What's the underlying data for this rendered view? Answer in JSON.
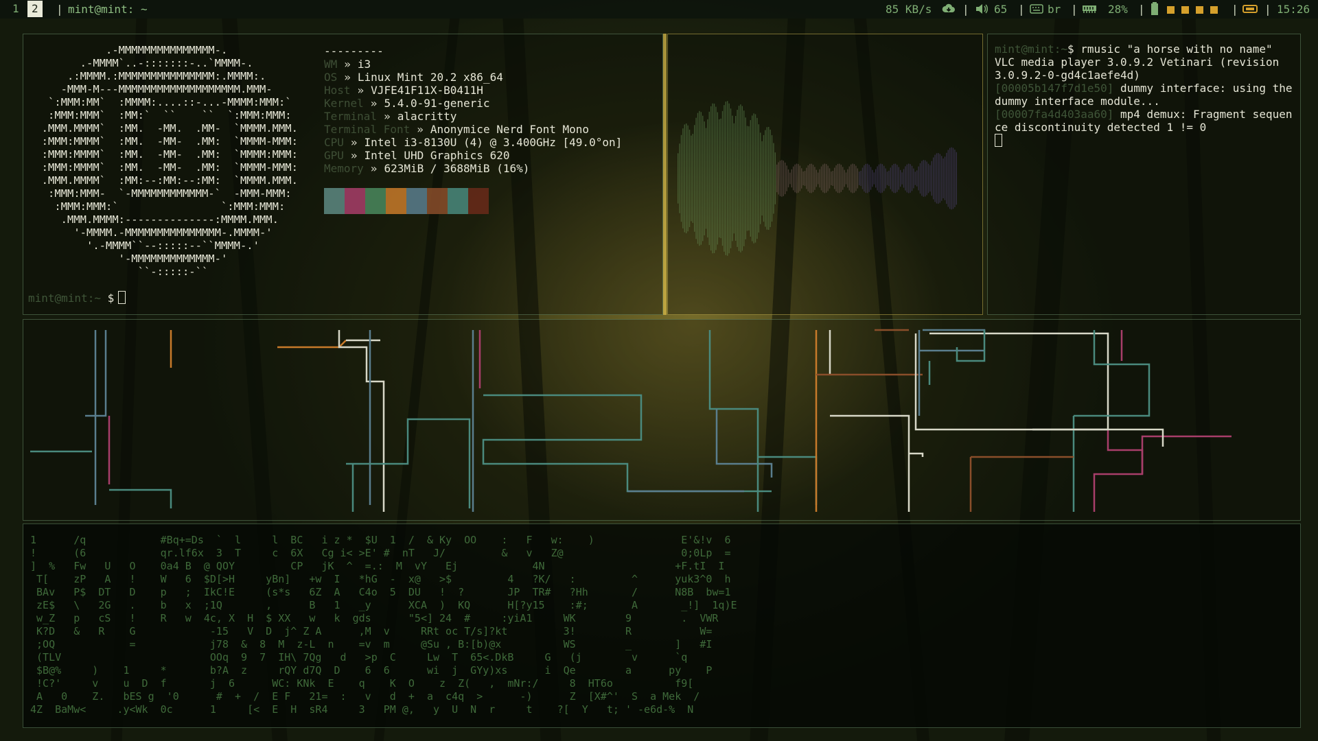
{
  "topbar": {
    "workspaces": [
      "1",
      "2"
    ],
    "active_workspace": "2",
    "window_title": "mint@mint: ~",
    "net_speed": "85 KB/s",
    "volume": "65",
    "keyboard_layout": "br",
    "memory_percent": "28%",
    "clock": "15:26",
    "icons": [
      "cloud-download-icon",
      "speaker-icon",
      "keyboard-icon",
      "memory-icon",
      "battery-icon",
      "ethernet-icon"
    ],
    "accent": "#d5a02c"
  },
  "neofetch": {
    "ascii_logo": "            .-MMMMMMMMMMMMMMM-.\n        .-MMMM`..-:::::::-..`MMMM-.\n      .:MMMM.:MMMMMMMMMMMMMMM:.MMMM:.\n     -MMM-M---MMMMMMMMMMMMMMMMMMM.MMM-\n   `:MMM:MM`  :MMMM:....::-...-MMMM:MMM:`\n   :MMM:MMM`  :MM:`  ``    ``  `:MMM:MMM:\n  .MMM.MMMM`  :MM.  -MM.  .MM-  `MMMM.MMM.\n  :MMM:MMMM`  :MM.  -MM-  .MM:  `MMMM-MMM:\n  :MMM:MMMM`  :MM.  -MM-  .MM:  `MMMM:MMM:\n  :MMM:MMMM`  :MM.  -MM-  .MM:  `MMMM-MMM:\n  .MMM.MMMM`  :MM:--:MM:--:MM:  `MMMM.MMM.\n   :MMM:MMM-  `-MMMMMMMMMMMM-`  -MMM-MMM:\n    :MMM:MMM:`                `:MMM:MMM:\n     .MMM.MMMM:--------------:MMMM.MMM.\n       '-MMMM.-MMMMMMMMMMMMMMM-.MMMM-'\n         '.-MMMM``--:::::--``MMMM-.'\n              '-MMMMMMMMMMMMM-'\n                 ``-:::::-``",
    "separator": "---------",
    "info": [
      {
        "key": "WM",
        "value": "i3"
      },
      {
        "key": "OS",
        "value": "Linux Mint 20.2 x86_64"
      },
      {
        "key": "Host",
        "value": "VJFE41F11X-B0411H"
      },
      {
        "key": "Kernel",
        "value": "5.4.0-91-generic"
      },
      {
        "key": "Terminal",
        "value": "alacritty"
      },
      {
        "key": "Terminal Font",
        "value": "Anonymice Nerd Font Mono"
      },
      {
        "key": "CPU",
        "value": "Intel i3-8130U (4) @ 3.400GHz [49.0°on]"
      },
      {
        "key": "GPU",
        "value": "Intel UHD Graphics 620"
      },
      {
        "key": "Memory",
        "value": "623MiB / 3688MiB (16%)"
      }
    ],
    "arrow": "»",
    "palette": [
      "#5d8a82",
      "#a83e6a",
      "#4a8a5e",
      "#c87a2a",
      "#5a7e8e",
      "#8a4e2a",
      "#4a8a7e",
      "#6a2a1a"
    ],
    "prompt_user": "mint@mint",
    "prompt_path": ":~",
    "prompt_symbol": "$"
  },
  "vlc_terminal": {
    "prompt_user": "mint@mint",
    "prompt_path": ":~",
    "command": "$ rmusic \"a horse with no name\"",
    "line1": "VLC media player 3.0.9.2 Vetinari (revision 3.0.9.2-0-gd4c1aefe4d)",
    "line2_addr": "[00005b147f7d1e50]",
    "line2_text": " dummy interface: using the dummy interface module...",
    "line3_addr": "[00007fa4d403aa60]",
    "line3_text": " mp4 demux: Fragment sequence discontinuity detected 1 != 0"
  },
  "matrix": {
    "color": "#3f6a3a",
    "rows": [
      "1      /q            #Bq+=Ds  `  l     l  BC   i z *  $U  1  /  & Ky  OO    :   F   w:    )              E'&!v  6",
      "!      (6            qr.lf6x  3  T     c  6X   Cg i< >E' #  nT   J/         &   v   Z@                   0;0Lp  =",
      "]  %   Fw   U   O    0a4 B  @ QOY         CP   jK  ^  =.:  M  vY   Ej            4N                     +F.tI  I",
      " T[    zP   A   !    W   6  $D[>H     yBn]   +w  I   *hG  -  x@   >$         4   ?K/   :         ^      yuk3^0  h",
      " BAv   P$  DT   D    p   ;  IkC!E     (s*s   6Z  A   C4o  5  DU   !  ?       JP  TR#   ?Hh       /      N8B  bw=1",
      " zE$   \\   2G   .    b   x  ;1Q       ,      B   1   _y      XCA  )  KQ      H[?y15    :#;       A       _!]  1q)E",
      " w_Z   p   cS   !    R   w  4c, X  H  $ XX   w   k  gds      \"5<] 24  #     :yiA1     WK        9        .  VWR",
      " K?D   &   R    G            -15   V  D  j^ Z A      ,M  v     RRt oc T/s]?kt         3!        R           W=",
      " ;OQ            =            j78  &  8  M  z-L  n    =v  m     @Su , B:[b)@x          WS        _       ]   #I",
      " (TLV                        OOq  9  7  IH\\ 7Qg   d   >p  C     Lw  T  65<.DkB     G   (j        v      `q",
      " $B@%     )    1     *       b?A  z     rQY d7Q  D    6  6      wi  j  GYy)xs      i  Qe        a      py    P",
      " !C?'     v    u  D  f       j  6      WC: KNk  E    q    K  O    z  Z(   ,  mNr:/     8  HT6o          f9[",
      " A   0    Z.   bES g  '0      #  +  /  E F   21=  :   v   d  +  a  c4q  >      -)      Z  [X#^'  S  a Mek  /",
      "4Z  BaMw<     .y<Wk  0c      1     [<  E  H  sR4     3   PM @,   y  U  N  r     t    ?[  Y   t; ' -e6d-%  N"
    ]
  }
}
